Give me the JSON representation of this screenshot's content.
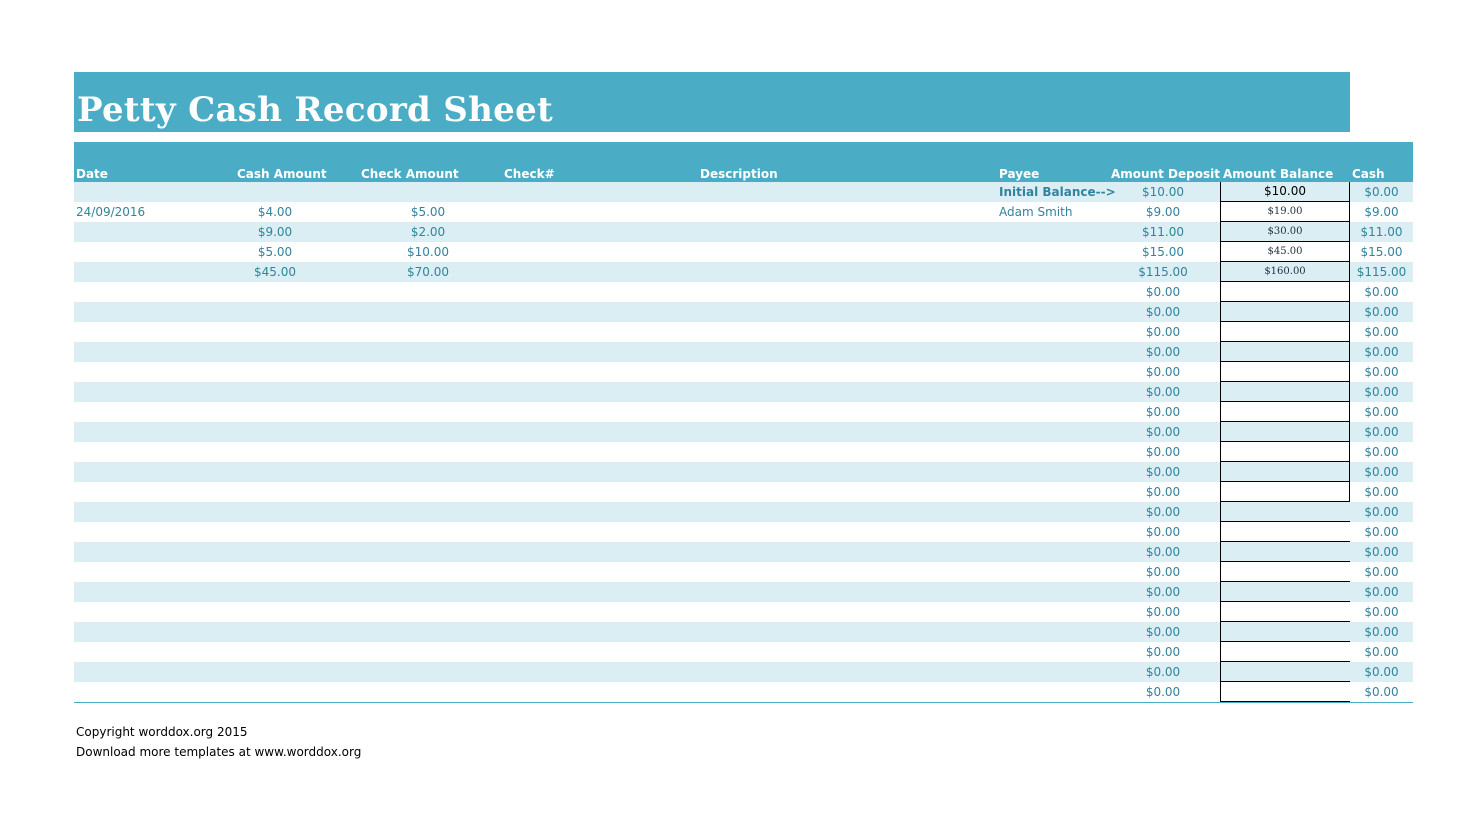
{
  "title": "Petty Cash Record Sheet",
  "headers": {
    "date": "Date",
    "cash_amount": "Cash Amount",
    "check_amount": "Check Amount",
    "check_no": "Check#",
    "description": "Description",
    "payee": "Payee",
    "amount_deposit": "Amount Deposit",
    "amount_balance": "Amount Balance",
    "cash": "Cash"
  },
  "initial": {
    "label": "Initial Balance-->",
    "deposit": "$10.00",
    "balance": "$10.00",
    "cash": "$0.00"
  },
  "rows": [
    {
      "date": "24/09/2016",
      "cash_amount": "$4.00",
      "check_amount": "$5.00",
      "check_no": "",
      "description": "",
      "payee": "Adam Smith",
      "deposit": "$9.00",
      "balance": "$19.00",
      "cash": "$9.00"
    },
    {
      "date": "",
      "cash_amount": "$9.00",
      "check_amount": "$2.00",
      "check_no": "",
      "description": "",
      "payee": "",
      "deposit": "$11.00",
      "balance": "$30.00",
      "cash": "$11.00"
    },
    {
      "date": "",
      "cash_amount": "$5.00",
      "check_amount": "$10.00",
      "check_no": "",
      "description": "",
      "payee": "",
      "deposit": "$15.00",
      "balance": "$45.00",
      "cash": "$15.00"
    },
    {
      "date": "",
      "cash_amount": "$45.00",
      "check_amount": "$70.00",
      "check_no": "",
      "description": "",
      "payee": "",
      "deposit": "$115.00",
      "balance": "$160.00",
      "cash": "$115.00"
    },
    {
      "date": "",
      "cash_amount": "",
      "check_amount": "",
      "check_no": "",
      "description": "",
      "payee": "",
      "deposit": "$0.00",
      "balance": "",
      "cash": "$0.00"
    },
    {
      "date": "",
      "cash_amount": "",
      "check_amount": "",
      "check_no": "",
      "description": "",
      "payee": "",
      "deposit": "$0.00",
      "balance": "",
      "cash": "$0.00"
    },
    {
      "date": "",
      "cash_amount": "",
      "check_amount": "",
      "check_no": "",
      "description": "",
      "payee": "",
      "deposit": "$0.00",
      "balance": "",
      "cash": "$0.00"
    },
    {
      "date": "",
      "cash_amount": "",
      "check_amount": "",
      "check_no": "",
      "description": "",
      "payee": "",
      "deposit": "$0.00",
      "balance": "",
      "cash": "$0.00"
    },
    {
      "date": "",
      "cash_amount": "",
      "check_amount": "",
      "check_no": "",
      "description": "",
      "payee": "",
      "deposit": "$0.00",
      "balance": "",
      "cash": "$0.00"
    },
    {
      "date": "",
      "cash_amount": "",
      "check_amount": "",
      "check_no": "",
      "description": "",
      "payee": "",
      "deposit": "$0.00",
      "balance": "",
      "cash": "$0.00"
    },
    {
      "date": "",
      "cash_amount": "",
      "check_amount": "",
      "check_no": "",
      "description": "",
      "payee": "",
      "deposit": "$0.00",
      "balance": "",
      "cash": "$0.00"
    },
    {
      "date": "",
      "cash_amount": "",
      "check_amount": "",
      "check_no": "",
      "description": "",
      "payee": "",
      "deposit": "$0.00",
      "balance": "",
      "cash": "$0.00"
    },
    {
      "date": "",
      "cash_amount": "",
      "check_amount": "",
      "check_no": "",
      "description": "",
      "payee": "",
      "deposit": "$0.00",
      "balance": "",
      "cash": "$0.00"
    },
    {
      "date": "",
      "cash_amount": "",
      "check_amount": "",
      "check_no": "",
      "description": "",
      "payee": "",
      "deposit": "$0.00",
      "balance": "",
      "cash": "$0.00"
    },
    {
      "date": "",
      "cash_amount": "",
      "check_amount": "",
      "check_no": "",
      "description": "",
      "payee": "",
      "deposit": "$0.00",
      "balance": "",
      "cash": "$0.00"
    },
    {
      "date": "",
      "cash_amount": "",
      "check_amount": "",
      "check_no": "",
      "description": "",
      "payee": "",
      "deposit": "$0.00",
      "balance": "",
      "cash": "$0.00"
    },
    {
      "date": "",
      "cash_amount": "",
      "check_amount": "",
      "check_no": "",
      "description": "",
      "payee": "",
      "deposit": "$0.00",
      "balance": "",
      "cash": "$0.00"
    },
    {
      "date": "",
      "cash_amount": "",
      "check_amount": "",
      "check_no": "",
      "description": "",
      "payee": "",
      "deposit": "$0.00",
      "balance": "",
      "cash": "$0.00"
    },
    {
      "date": "",
      "cash_amount": "",
      "check_amount": "",
      "check_no": "",
      "description": "",
      "payee": "",
      "deposit": "$0.00",
      "balance": "",
      "cash": "$0.00"
    },
    {
      "date": "",
      "cash_amount": "",
      "check_amount": "",
      "check_no": "",
      "description": "",
      "payee": "",
      "deposit": "$0.00",
      "balance": "",
      "cash": "$0.00"
    },
    {
      "date": "",
      "cash_amount": "",
      "check_amount": "",
      "check_no": "",
      "description": "",
      "payee": "",
      "deposit": "$0.00",
      "balance": "",
      "cash": "$0.00"
    },
    {
      "date": "",
      "cash_amount": "",
      "check_amount": "",
      "check_no": "",
      "description": "",
      "payee": "",
      "deposit": "$0.00",
      "balance": "",
      "cash": "$0.00"
    },
    {
      "date": "",
      "cash_amount": "",
      "check_amount": "",
      "check_no": "",
      "description": "",
      "payee": "",
      "deposit": "$0.00",
      "balance": "",
      "cash": "$0.00"
    },
    {
      "date": "",
      "cash_amount": "",
      "check_amount": "",
      "check_no": "",
      "description": "",
      "payee": "",
      "deposit": "$0.00",
      "balance": "",
      "cash": "$0.00"
    },
    {
      "date": "",
      "cash_amount": "",
      "check_amount": "",
      "check_no": "",
      "description": "",
      "payee": "",
      "deposit": "$0.00",
      "balance": "",
      "cash": "$0.00"
    }
  ],
  "footer": {
    "copyright": "Copyright worddox.org 2015",
    "download": "Download more templates at www.worddox.org"
  }
}
